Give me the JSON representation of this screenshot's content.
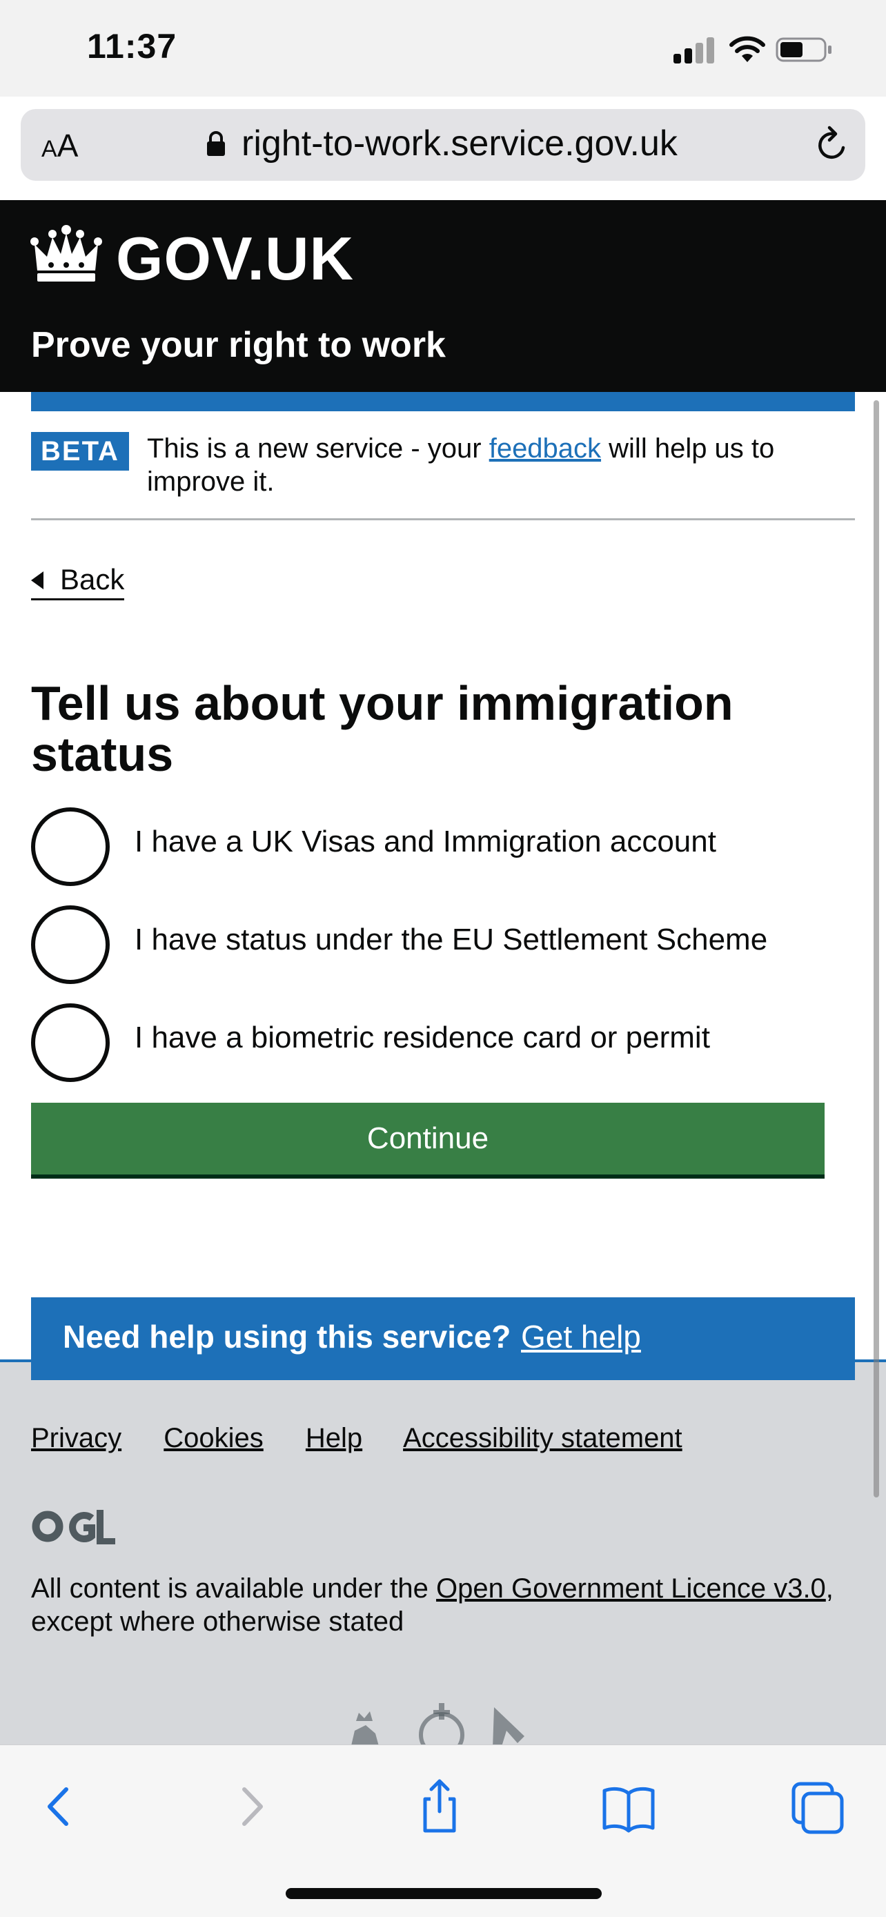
{
  "status_bar": {
    "time": "11:37"
  },
  "url_bar": {
    "aa_small": "A",
    "aa_large": "A",
    "url": "right-to-work.service.gov.uk"
  },
  "header": {
    "logo_text": "GOV.UK",
    "service_name": "Prove your right to work"
  },
  "phase_banner": {
    "tag": "BETA",
    "text_before": "This is a new service - your ",
    "link": "feedback",
    "text_after": " will help us to improve it."
  },
  "back_link": "Back",
  "question": {
    "heading": "Tell us about your immigration status",
    "options": [
      {
        "label": "I have a UK Visas and Immigration account"
      },
      {
        "label": "I have status under the EU Settlement Scheme"
      },
      {
        "label": "I have a biometric residence card or permit"
      }
    ]
  },
  "continue_button": "Continue",
  "help_banner": {
    "text": "Need help using this service?",
    "link": "Get help"
  },
  "footer": {
    "links": [
      "Privacy",
      "Cookies",
      "Help",
      "Accessibility statement"
    ],
    "licence_before": "All content is available under the ",
    "licence_link": "Open Government Licence v3.0",
    "licence_after": ", except where otherwise stated"
  },
  "toolbar_icons": [
    "back-icon",
    "forward-icon",
    "share-icon",
    "bookmarks-icon",
    "tabs-icon"
  ],
  "colors": {
    "govuk_blue": "#1d70b8",
    "govuk_black": "#0b0c0c",
    "button_green": "#387f45",
    "footer_grey": "#d6d8db"
  }
}
